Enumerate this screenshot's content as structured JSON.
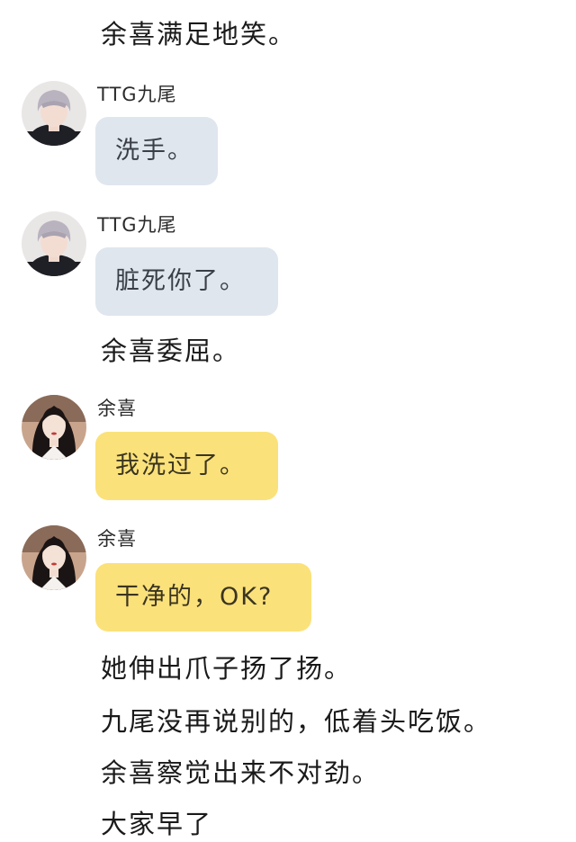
{
  "story": {
    "line_top": "余喜满足地笑。",
    "line_mid": "余喜委屈。",
    "line_b1": "她伸出爪子扬了扬。",
    "line_b2": "九尾没再说别的，低着头吃饭。",
    "line_b3": "余喜察觉出来不对劲。",
    "line_b4": "大家早了"
  },
  "messages": [
    {
      "sender": "TTG九尾",
      "text": "洗手。",
      "style": "grey",
      "avatar": "male-avatar"
    },
    {
      "sender": "TTG九尾",
      "text": "脏死你了。",
      "style": "grey",
      "avatar": "male-avatar"
    },
    {
      "sender": "余喜",
      "text": "我洗过了。",
      "style": "yellow",
      "avatar": "female-avatar"
    },
    {
      "sender": "余喜",
      "text": "干净的，OK?",
      "style": "yellow",
      "avatar": "female-avatar"
    }
  ],
  "colors": {
    "grey_bubble": "#dfe6ee",
    "yellow_bubble": "#fbe17a",
    "background": "#ffffff"
  }
}
